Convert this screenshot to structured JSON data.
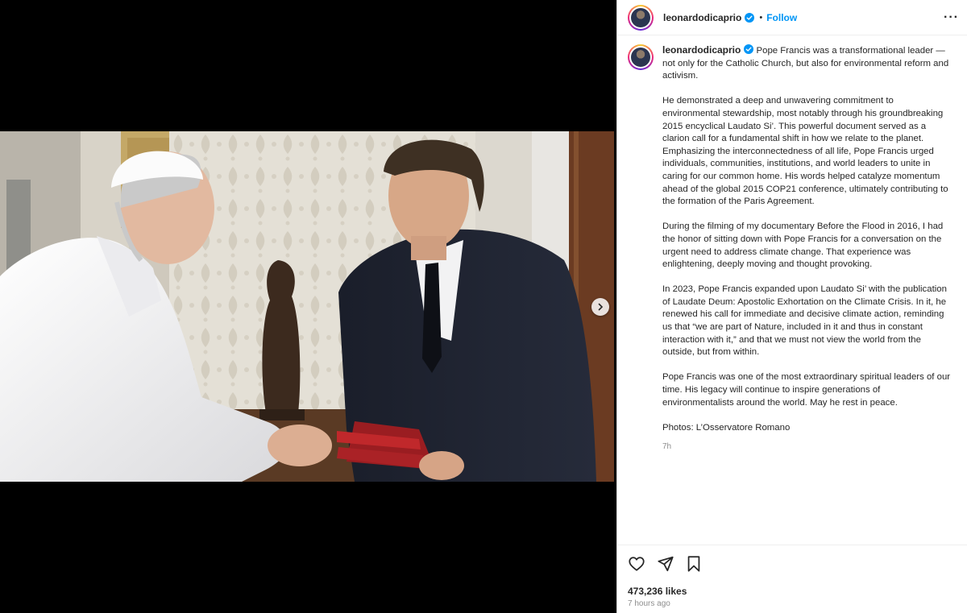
{
  "post": {
    "username": "leonardodicaprio",
    "follow_label": "Follow",
    "separator": "•",
    "more_label": "···",
    "caption": {
      "p1": "Pope Francis was a transformational leader — not only for the Catholic Church, but also for environmental reform and activism.",
      "p2": "He demonstrated a deep and unwavering commitment to environmental stewardship, most notably through his groundbreaking 2015 encyclical Laudato Si’. This powerful document served as a clarion call for a fundamental shift in how we relate to the planet. Emphasizing the interconnectedness of all life, Pope Francis urged individuals, communities, institutions, and world leaders to unite in caring for our common home. His words helped catalyze momentum ahead of the global 2015 COP21 conference, ultimately contributing to the formation of the Paris Agreement.",
      "p3": "During the filming of my documentary Before the Flood in 2016, I had the honor of sitting down with Pope Francis for a conversation on the urgent need to address climate change. That experience was enlightening, deeply moving and thought provoking.",
      "p4": "In 2023, Pope Francis expanded upon Laudato Si’ with the publication of Laudate Deum: Apostolic Exhortation on the Climate Crisis. In it, he renewed his call for immediate and decisive climate action, reminding us that “we are part of Nature, included in it and thus in constant interaction with it,” and that we must not view the world from the outside, but from within.",
      "p5": "Pope Francis was one of the most extraordinary spiritual leaders of our time. His legacy will continue to inspire generations of environmentalists around the world. May he rest in peace.",
      "p6": "Photos: L’Osservatore Romano",
      "time": "7h"
    },
    "likes": "473,236 likes",
    "posted_ago": "7 hours ago"
  },
  "colors": {
    "accent": "#0095f6",
    "verified": "#0095f6",
    "muted": "#8e8e8e"
  },
  "icons": {
    "like": "heart-icon",
    "share": "paper-plane-icon",
    "save": "bookmark-icon",
    "next": "chevron-right-icon",
    "verified": "verified-badge-icon"
  }
}
